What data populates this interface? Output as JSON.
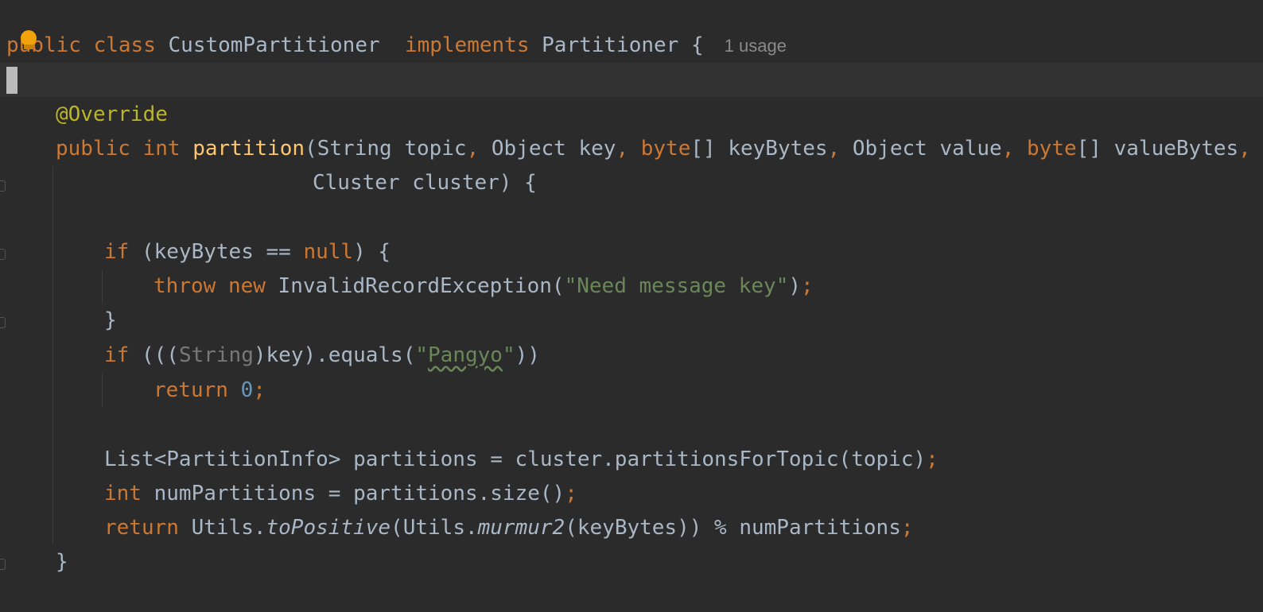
{
  "editor": {
    "usage_hint": "1 usage",
    "lines": {
      "l1": {
        "kw1": "public",
        "kw2": "class",
        "name": "CustomPartitioner",
        "kw3": "implements",
        "iface": "Partitioner",
        "brace": "{"
      },
      "l3": {
        "annotation": "@Override"
      },
      "l4": {
        "kw1": "public",
        "kw2": "int",
        "method": "partition",
        "p1": "(String topic",
        "c1": ",",
        "p2": " Object key",
        "c2": ",",
        "t3": " byte",
        "p3": "[] keyBytes",
        "c3": ",",
        "p4": " Object value",
        "c4": ",",
        "t5": " byte",
        "p5": "[] valueBytes",
        "c5": ","
      },
      "l5": {
        "text": "Cluster cluster) {"
      },
      "l7": {
        "kw": "if",
        "a": " (keyBytes == ",
        "null": "null",
        "b": ") {"
      },
      "l8": {
        "kw1": "throw",
        "kw2": "new",
        "cls": " InvalidRecordException(",
        "str": "\"Need message key\"",
        "end": ")",
        "semi": ";"
      },
      "l9": {
        "text": "}"
      },
      "l10": {
        "kw": "if",
        "a": " (((",
        "cast": "String",
        "b": ")key).equals(",
        "q1": "\"",
        "str": "Pangyo",
        "q2": "\"",
        "c": "))"
      },
      "l11": {
        "kw": "return",
        "num": "0",
        "semi": ";"
      },
      "l13": {
        "text": "List<PartitionInfo> partitions = cluster.partitionsForTopic(topic)",
        "semi": ";"
      },
      "l14": {
        "kw": "int",
        "text": " numPartitions = partitions.size()",
        "semi": ";"
      },
      "l15": {
        "kw": "return",
        "a": " Utils.",
        "m1": "toPositive",
        "b": "(Utils.",
        "m2": "murmur2",
        "c": "(keyBytes)) % numPartitions",
        "semi": ";"
      },
      "l16": {
        "text": "}"
      }
    },
    "colors": {
      "background": "#2b2b2b",
      "keyword": "#cc7832",
      "string": "#6a8759",
      "number": "#6897bb",
      "annotation": "#bbb529",
      "method_decl": "#ffc66d",
      "default_text": "#a9b7c6"
    },
    "icons": [
      "intention-bulb-icon",
      "fold-marker-icon"
    ]
  }
}
